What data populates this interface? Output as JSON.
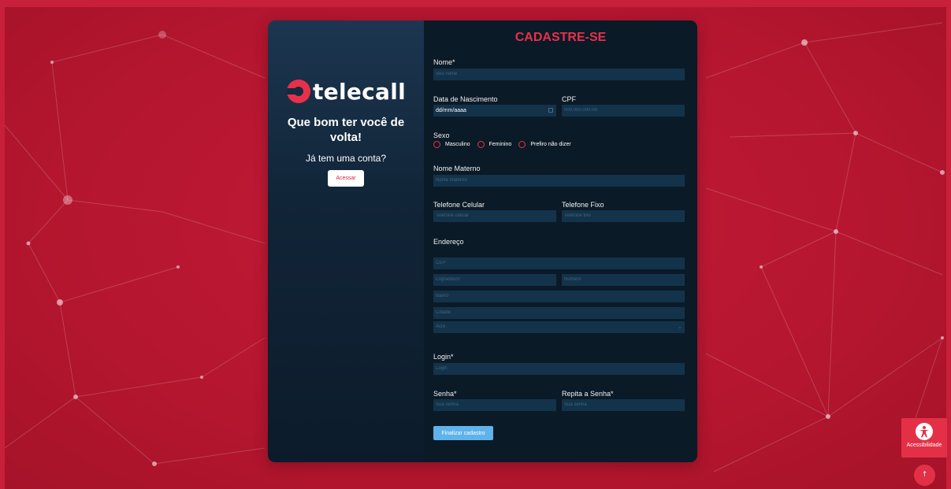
{
  "brand": {
    "logo_text": "telecall"
  },
  "left": {
    "welcome": "Que bom ter você de volta!",
    "have_account": "Já tem uma conta?",
    "access_button": "Acessar"
  },
  "form": {
    "title": "CADASTRE-SE",
    "name": {
      "label": "Nome*",
      "placeholder": "Seu nome"
    },
    "birth": {
      "label": "Data de Nascimento",
      "value": "dd/mm/aaaa"
    },
    "cpf": {
      "label": "CPF",
      "placeholder": "000.000.000-00"
    },
    "sex": {
      "label": "Sexo",
      "options": [
        "Masculino",
        "Feminino",
        "Prefiro não dizer"
      ]
    },
    "mother_name": {
      "label": "Nome Materno",
      "placeholder": "Nome materno"
    },
    "mobile": {
      "label": "Telefone Celular",
      "placeholder": "Telefone celular"
    },
    "landline": {
      "label": "Telefone Fixo",
      "placeholder": "Telefone fixo"
    },
    "address": {
      "label": "Endereço",
      "cep_placeholder": "CEP",
      "street_placeholder": "Logradouro",
      "number_placeholder": "Número",
      "district_placeholder": "Bairro",
      "city_placeholder": "Cidade",
      "state_selected": "Acre"
    },
    "login": {
      "label": "Login*",
      "placeholder": "Login"
    },
    "password": {
      "label": "Senha*",
      "placeholder": "Sua senha"
    },
    "password_repeat": {
      "label": "Repita a Senha*",
      "placeholder": "Sua senha"
    },
    "submit": "Finalizar cadastro"
  },
  "widgets": {
    "accessibility_label": "Acessibilidade",
    "accessibility_icon": "accessibility-icon",
    "back_to_top_icon": "arrow-up-icon"
  },
  "colors": {
    "background": "#c8203a",
    "panel_dark": "#0b1a27",
    "accent": "#e8304a",
    "input_bg": "#13334a",
    "submit": "#5fb3ea"
  }
}
